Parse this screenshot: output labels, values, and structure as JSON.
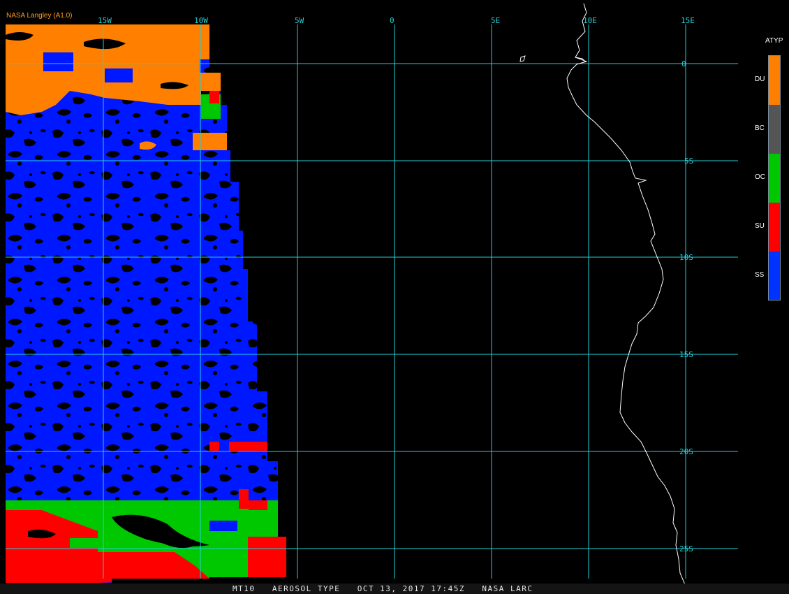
{
  "title": "NASA Langley (A1.0)",
  "footer": "MT10   AEROSOL TYPE   OCT 13, 2017 17:45Z   NASA LARC",
  "colors": {
    "grid": "#22d0d8",
    "coastline": "#ffffff",
    "title": "#ff9d1f",
    "background": "#000000"
  },
  "longitude_labels": [
    "15W",
    "10W",
    "5W",
    "0",
    "5E",
    "10E",
    "15E"
  ],
  "latitude_labels": [
    "0",
    "5S",
    "10S",
    "15S",
    "20S",
    "25S"
  ],
  "legend": {
    "title": "ATYP",
    "items": [
      {
        "code": "DU",
        "color": "#ff7f00"
      },
      {
        "code": "BC",
        "color": "#555555"
      },
      {
        "code": "OC",
        "color": "#00c800"
      },
      {
        "code": "SU",
        "color": "#ff0000"
      },
      {
        "code": "SS",
        "color": "#0033ff"
      }
    ]
  }
}
